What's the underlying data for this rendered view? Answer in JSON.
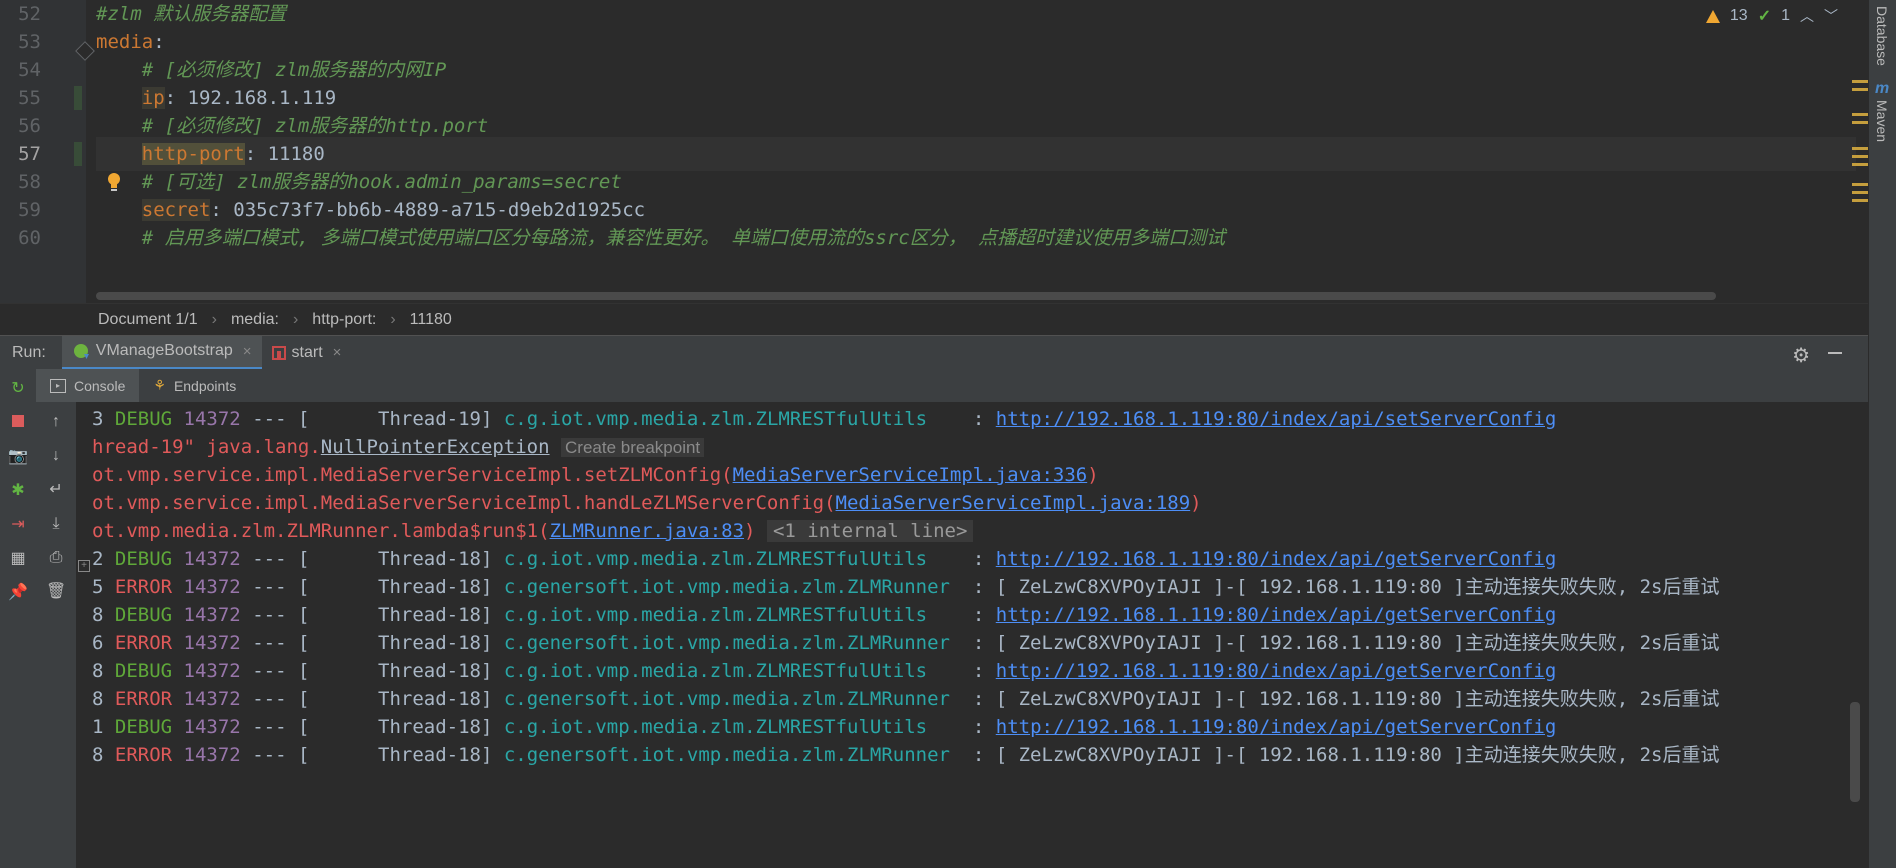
{
  "editor": {
    "lines": [
      {
        "num": "52",
        "parts": [
          {
            "cls": "cmt",
            "text": "#zlm 默认服务器配置"
          }
        ]
      },
      {
        "num": "53",
        "parts": [
          {
            "cls": "key",
            "text": "media"
          },
          {
            "cls": "val",
            "text": ":"
          }
        ]
      },
      {
        "num": "54",
        "parts": [
          {
            "cls": "cmt",
            "text": "    # [必须修改] zlm服务器的内网IP"
          }
        ]
      },
      {
        "num": "55",
        "parts": [
          {
            "cls": "val",
            "text": "    "
          },
          {
            "cls": "key-hl",
            "text": "ip"
          },
          {
            "cls": "val",
            "text": ": 192.168.1.119"
          }
        ]
      },
      {
        "num": "56",
        "parts": [
          {
            "cls": "cmt",
            "text": "    # [必须修改] zlm服务器的http.port"
          }
        ]
      },
      {
        "num": "57",
        "parts": [
          {
            "cls": "val",
            "text": "    "
          },
          {
            "cls": "key-yellow",
            "text": "http-port"
          },
          {
            "cls": "val",
            "text": ": 11180"
          }
        ],
        "current": true
      },
      {
        "num": "58",
        "parts": [
          {
            "cls": "cmt",
            "text": "    # [可选] zlm服务器的hook.admin_params=secret"
          }
        ]
      },
      {
        "num": "59",
        "parts": [
          {
            "cls": "val",
            "text": "    "
          },
          {
            "cls": "key-hl",
            "text": "secret"
          },
          {
            "cls": "val",
            "text": ": 035c73f7-bb6b-4889-a715-d9eb2d1925cc"
          }
        ]
      },
      {
        "num": "60",
        "parts": [
          {
            "cls": "cmt",
            "text": "    # 启用多端口模式, 多端口模式使用端口区分每路流，兼容性更好。 单端口使用流的ssrc区分， 点播超时建议使用多端口测试"
          }
        ]
      }
    ],
    "inspection": {
      "warnings": "13",
      "weak_warnings": "1"
    }
  },
  "breadcrumb": [
    "Document 1/1",
    "media:",
    "http-port:",
    "11180"
  ],
  "run": {
    "label": "Run:",
    "tabs": [
      {
        "label": "VManageBootstrap",
        "icon": "spring-boot-icon",
        "active": true
      },
      {
        "label": "start",
        "icon": "npm-icon",
        "active": false
      }
    ]
  },
  "console_tabs": [
    {
      "label": "Console",
      "icon": "console-icon"
    },
    {
      "label": "Endpoints",
      "icon": "endpoints-icon"
    }
  ],
  "right_strip": {
    "database": "Database",
    "maven": "Maven",
    "maven_glyph": "m"
  },
  "console": {
    "lines": [
      [
        {
          "cls": "val",
          "text": "3 "
        },
        {
          "cls": "debug",
          "text": "DEBUG"
        },
        {
          "cls": "val",
          "text": " "
        },
        {
          "cls": "pid",
          "text": "14372"
        },
        {
          "cls": "val",
          "text": " --- [      Thread-19] "
        },
        {
          "cls": "cyan",
          "text": "c.g.iot.vmp.media.zlm.ZLMRESTfulUtils   "
        },
        {
          "cls": "val",
          "text": " : "
        },
        {
          "cls": "link",
          "text": "http://192.168.1.119:80/index/api/setServerConfig"
        }
      ],
      [
        {
          "cls": "redtxt",
          "text": "hread-19\" java.lang."
        },
        {
          "cls": "npe",
          "text": "NullPointerException"
        },
        {
          "cls": "val",
          "text": " "
        },
        {
          "cls": "hint",
          "text": "Create breakpoint"
        }
      ],
      [
        {
          "cls": "redtxt",
          "text": "ot.vmp.service.impl.MediaServerServiceImpl.setZLMConfig("
        },
        {
          "cls": "link",
          "text": "MediaServerServiceImpl.java:336"
        },
        {
          "cls": "redtxt",
          "text": ")"
        }
      ],
      [
        {
          "cls": "redtxt",
          "text": "ot.vmp.service.impl.MediaServerServiceImpl.handLeZLMServerConfig("
        },
        {
          "cls": "link",
          "text": "MediaServerServiceImpl.java:189"
        },
        {
          "cls": "redtxt",
          "text": ")"
        }
      ],
      [
        {
          "cls": "redtxt",
          "text": "ot.vmp.media.zlm.ZLMRunner.lambda$run$1("
        },
        {
          "cls": "link",
          "text": "ZLMRunner.java:83"
        },
        {
          "cls": "redtxt",
          "text": ")"
        },
        {
          "cls": "val",
          "text": " "
        },
        {
          "cls": "internal",
          "text": "<1 internal line>"
        }
      ],
      [
        {
          "cls": "val",
          "text": "2 "
        },
        {
          "cls": "debug",
          "text": "DEBUG"
        },
        {
          "cls": "val",
          "text": " "
        },
        {
          "cls": "pid",
          "text": "14372"
        },
        {
          "cls": "val",
          "text": " --- [      Thread-18] "
        },
        {
          "cls": "cyan",
          "text": "c.g.iot.vmp.media.zlm.ZLMRESTfulUtils   "
        },
        {
          "cls": "val",
          "text": " : "
        },
        {
          "cls": "link",
          "text": "http://192.168.1.119:80/index/api/getServerConfig"
        }
      ],
      [
        {
          "cls": "val",
          "text": "5 "
        },
        {
          "cls": "error",
          "text": "ERROR"
        },
        {
          "cls": "val",
          "text": " "
        },
        {
          "cls": "pid",
          "text": "14372"
        },
        {
          "cls": "val",
          "text": " --- [      Thread-18] "
        },
        {
          "cls": "cyan",
          "text": "c.genersoft.iot.vmp.media.zlm.ZLMRunner "
        },
        {
          "cls": "val",
          "text": " : [ ZeLzwC8XVPOyIAJI ]-[ 192.168.1.119:80 ]主动连接失败失败, 2s后重试"
        }
      ],
      [
        {
          "cls": "val",
          "text": "8 "
        },
        {
          "cls": "debug",
          "text": "DEBUG"
        },
        {
          "cls": "val",
          "text": " "
        },
        {
          "cls": "pid",
          "text": "14372"
        },
        {
          "cls": "val",
          "text": " --- [      Thread-18] "
        },
        {
          "cls": "cyan",
          "text": "c.g.iot.vmp.media.zlm.ZLMRESTfulUtils   "
        },
        {
          "cls": "val",
          "text": " : "
        },
        {
          "cls": "link",
          "text": "http://192.168.1.119:80/index/api/getServerConfig"
        }
      ],
      [
        {
          "cls": "val",
          "text": "6 "
        },
        {
          "cls": "error",
          "text": "ERROR"
        },
        {
          "cls": "val",
          "text": " "
        },
        {
          "cls": "pid",
          "text": "14372"
        },
        {
          "cls": "val",
          "text": " --- [      Thread-18] "
        },
        {
          "cls": "cyan",
          "text": "c.genersoft.iot.vmp.media.zlm.ZLMRunner "
        },
        {
          "cls": "val",
          "text": " : [ ZeLzwC8XVPOyIAJI ]-[ 192.168.1.119:80 ]主动连接失败失败, 2s后重试"
        }
      ],
      [
        {
          "cls": "val",
          "text": "8 "
        },
        {
          "cls": "debug",
          "text": "DEBUG"
        },
        {
          "cls": "val",
          "text": " "
        },
        {
          "cls": "pid",
          "text": "14372"
        },
        {
          "cls": "val",
          "text": " --- [      Thread-18] "
        },
        {
          "cls": "cyan",
          "text": "c.g.iot.vmp.media.zlm.ZLMRESTfulUtils   "
        },
        {
          "cls": "val",
          "text": " : "
        },
        {
          "cls": "link",
          "text": "http://192.168.1.119:80/index/api/getServerConfig"
        }
      ],
      [
        {
          "cls": "val",
          "text": "8 "
        },
        {
          "cls": "error",
          "text": "ERROR"
        },
        {
          "cls": "val",
          "text": " "
        },
        {
          "cls": "pid",
          "text": "14372"
        },
        {
          "cls": "val",
          "text": " --- [      Thread-18] "
        },
        {
          "cls": "cyan",
          "text": "c.genersoft.iot.vmp.media.zlm.ZLMRunner "
        },
        {
          "cls": "val",
          "text": " : [ ZeLzwC8XVPOyIAJI ]-[ 192.168.1.119:80 ]主动连接失败失败, 2s后重试"
        }
      ],
      [
        {
          "cls": "val",
          "text": "1 "
        },
        {
          "cls": "debug",
          "text": "DEBUG"
        },
        {
          "cls": "val",
          "text": " "
        },
        {
          "cls": "pid",
          "text": "14372"
        },
        {
          "cls": "val",
          "text": " --- [      Thread-18] "
        },
        {
          "cls": "cyan",
          "text": "c.g.iot.vmp.media.zlm.ZLMRESTfulUtils   "
        },
        {
          "cls": "val",
          "text": " : "
        },
        {
          "cls": "link",
          "text": "http://192.168.1.119:80/index/api/getServerConfig"
        }
      ],
      [
        {
          "cls": "val",
          "text": "8 "
        },
        {
          "cls": "error",
          "text": "ERROR"
        },
        {
          "cls": "val",
          "text": " "
        },
        {
          "cls": "pid",
          "text": "14372"
        },
        {
          "cls": "val",
          "text": " --- [      Thread-18] "
        },
        {
          "cls": "cyan",
          "text": "c.genersoft.iot.vmp.media.zlm.ZLMRunner "
        },
        {
          "cls": "val",
          "text": " : [ ZeLzwC8XVPOyIAJI ]-[ 192.168.1.119:80 ]主动连接失败失败, 2s后重试"
        }
      ]
    ]
  },
  "colors": {
    "editor_bg": "#2b2b2b",
    "gutter_bg": "#313335",
    "panel_bg": "#3c3f41",
    "comment": "#629755",
    "yaml_key": "#cc7832",
    "debug": "#5fa839",
    "error": "#e05a5a",
    "pid": "#9876aa",
    "logger": "#2aa6a6",
    "link": "#4d8ef6"
  }
}
